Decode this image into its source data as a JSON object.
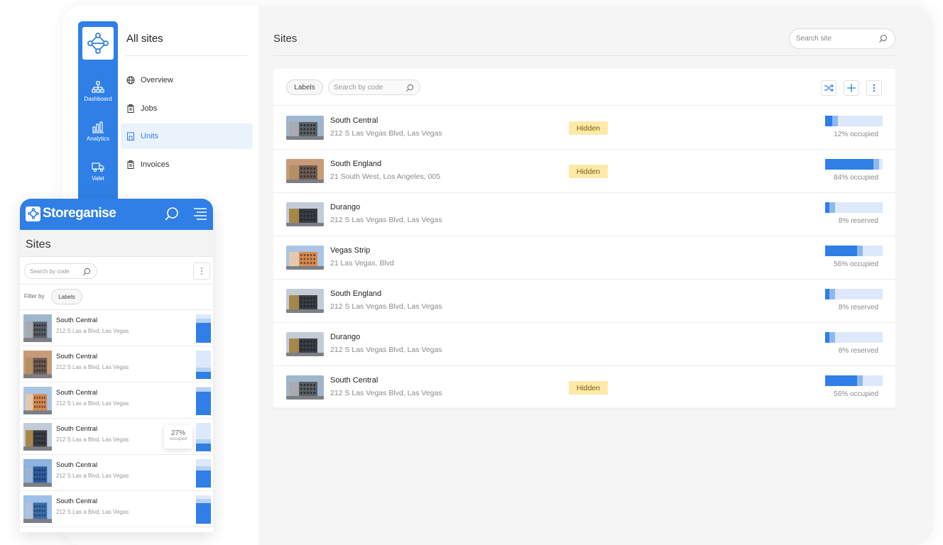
{
  "desktop": {
    "rail": {
      "items": [
        {
          "label": "Dashboard",
          "icon": "sitemap-icon"
        },
        {
          "label": "Analytics",
          "icon": "bar-chart-icon"
        },
        {
          "label": "Valet",
          "icon": "truck-icon"
        }
      ]
    },
    "subnav": {
      "title": "All sites",
      "items": [
        {
          "label": "Overview",
          "icon": "globe-icon",
          "active": false
        },
        {
          "label": "Jobs",
          "icon": "clipboard-icon",
          "active": false
        },
        {
          "label": "Units",
          "icon": "unit-icon",
          "active": true
        },
        {
          "label": "Invoices",
          "icon": "clipboard-icon",
          "active": false
        }
      ]
    },
    "main": {
      "title": "Sites",
      "search_placeholder": "Search site",
      "toolbar": {
        "labels_chip": "Labels",
        "search_placeholder": "Search by code"
      },
      "sites": [
        {
          "name": "South Central",
          "address": "212 S Las Vegas Blvd, Las Vegas",
          "badge": "Hidden",
          "occupancy": 0.12,
          "occupancy_label": "12% occupied",
          "thumb": "building-a"
        },
        {
          "name": "South England",
          "address": "21 South West, Los Angeles, 005",
          "badge": "Hidden",
          "occupancy": 0.84,
          "occupancy_label": "84% occupied",
          "thumb": "building-b"
        },
        {
          "name": "Durango",
          "address": "212 S Las Vegas Blvd, Las Vegas",
          "badge": "",
          "occupancy": 0.08,
          "occupancy_label": "8% reserved",
          "thumb": "building-c"
        },
        {
          "name": "Vegas Strip",
          "address": "21 Las Vegas, Blvd",
          "badge": "",
          "occupancy": 0.56,
          "occupancy_label": "56% occupied",
          "thumb": "building-d"
        },
        {
          "name": "South England",
          "address": "212 S Las Vegas Blvd, Las Vegas",
          "badge": "",
          "occupancy": 0.08,
          "occupancy_label": "8% reserved",
          "thumb": "building-c"
        },
        {
          "name": "Durango",
          "address": "212 S Las Vegas Blvd, Las Vegas",
          "badge": "",
          "occupancy": 0.08,
          "occupancy_label": "8% reserved",
          "thumb": "building-c"
        },
        {
          "name": "South Central",
          "address": "212 S Las Vegas Blvd, Las Vegas",
          "badge": "Hidden",
          "occupancy": 0.56,
          "occupancy_label": "56% occupied",
          "thumb": "building-a"
        }
      ]
    }
  },
  "mobile": {
    "brand": "Storeganise",
    "title": "Sites",
    "search_placeholder": "Search by code",
    "filter_label": "Filter by",
    "labels_chip": "Labels",
    "tooltip": {
      "value": "27%",
      "label": "occupied"
    },
    "sites": [
      {
        "name": "South Central",
        "address": "212 S Las a Blvd, Las Vegas",
        "occupancy": 0.7,
        "thumb": "building-a"
      },
      {
        "name": "South Central",
        "address": "212 S Las a Blvd, Las Vegas",
        "occupancy": 0.25,
        "thumb": "building-b"
      },
      {
        "name": "South Central",
        "address": "212 S Las a Blvd, Las Vegas",
        "occupancy": 0.82,
        "thumb": "building-d"
      },
      {
        "name": "South Central",
        "address": "212 S Las a Blvd, Las Vegas",
        "occupancy": 0.27,
        "thumb": "building-c"
      },
      {
        "name": "South Central",
        "address": "212 S Las a Blvd, Las Vegas",
        "occupancy": 0.6,
        "thumb": "building-e"
      },
      {
        "name": "South Central",
        "address": "212 S Las a Blvd, Las Vegas",
        "occupancy": 0.72,
        "thumb": "building-f"
      }
    ]
  },
  "colors": {
    "brand_blue": "#2f7fe6",
    "badge_bg": "#fde9a8",
    "bar_bg": "#dde9fb"
  }
}
